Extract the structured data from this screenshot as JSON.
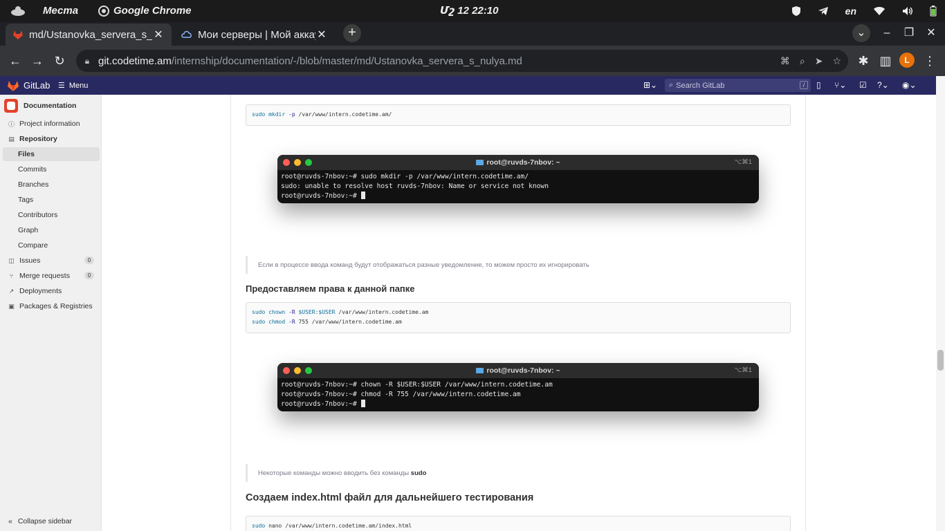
{
  "system_bar": {
    "places": "Места",
    "app_name": "Google Chrome",
    "clock": "Մշ 12  22:10",
    "lang": "en"
  },
  "tabs": [
    {
      "title": "md/Ustanovka_servera_s_nulya.md",
      "active": true
    },
    {
      "title": "Мои серверы | Мой аккаунт",
      "active": false
    }
  ],
  "address_bar": {
    "host": "git.codetime.am",
    "path": "/internship/documentation/-/blob/master/md/Ustanovka_servera_s_nulya.md"
  },
  "profile_initial": "L",
  "gitlab": {
    "brand": "GitLab",
    "menu": "Menu",
    "search_placeholder": "Search GitLab",
    "search_shortcut": "/"
  },
  "sidebar": {
    "project": "Documentation",
    "items": [
      {
        "label": "Project information"
      },
      {
        "label": "Repository"
      },
      {
        "label": "Files"
      },
      {
        "label": "Commits"
      },
      {
        "label": "Branches"
      },
      {
        "label": "Tags"
      },
      {
        "label": "Contributors"
      },
      {
        "label": "Graph"
      },
      {
        "label": "Compare"
      },
      {
        "label": "Issues",
        "count": "0"
      },
      {
        "label": "Merge requests",
        "count": "0"
      },
      {
        "label": "Deployments"
      },
      {
        "label": "Packages & Registries"
      }
    ],
    "collapse": "Collapse sidebar"
  },
  "doc": {
    "code1": {
      "cmd": "sudo",
      "sub": "mkdir",
      "flag": "-p",
      "arg": "/var/www/intern.codetime.am/"
    },
    "term1": {
      "title": "root@ruvds-7nbov: ~",
      "shortcut": "⌥⌘1",
      "lines": [
        "root@ruvds-7nbov:~# sudo mkdir -p /var/www/intern.codetime.am/",
        "sudo: unable to resolve host ruvds-7nbov: Name or service not known",
        "root@ruvds-7nbov:~# "
      ]
    },
    "note1": "Если в процессе ввода команд будут отображаться разные уведомление, то можем просто их игнорировать",
    "heading2": "Предоставляем права к данной папке",
    "code2": {
      "l1": {
        "cmd": "sudo",
        "sub": "chown",
        "flag": "-R",
        "var": "$USER:$USER",
        "arg": "/var/www/intern.codetime.am"
      },
      "l2": {
        "cmd": "sudo",
        "sub": "chmod",
        "flag": "-R",
        "arg": "755 /var/www/intern.codetime.am"
      }
    },
    "term2": {
      "title": "root@ruvds-7nbov: ~",
      "shortcut": "⌥⌘1",
      "lines": [
        "root@ruvds-7nbov:~# chown -R $USER:$USER /var/www/intern.codetime.am",
        "root@ruvds-7nbov:~# chmod -R 755 /var/www/intern.codetime.am",
        "root@ruvds-7nbov:~# "
      ]
    },
    "note2_prefix": "Некоторые команды можно вводить без команды ",
    "note2_bold": "sudo",
    "heading3": "Создаем index.html файл для дальнейшего тестирования",
    "code3": {
      "cmd": "sudo",
      "sub": "nano",
      "arg": "/var/www/intern.codetime.am/index.html"
    }
  }
}
